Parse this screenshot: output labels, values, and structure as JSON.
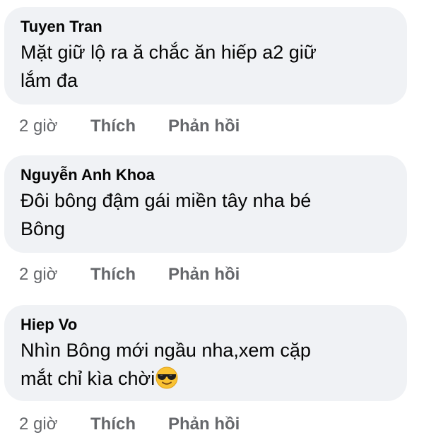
{
  "comments": [
    {
      "author": "Tuyen Tran",
      "text": "Mặt giữ lộ ra ă chắc ăn hiếp a2 giữ\nlắm đa",
      "time": "2 giờ",
      "like": "Thích",
      "reply": "Phản hồi"
    },
    {
      "author": "Nguyễn Anh Khoa",
      "text": "Đôi bông đậm gái miền tây nha bé\nBông",
      "time": "2 giờ",
      "like": "Thích",
      "reply": "Phản hồi"
    },
    {
      "author": "Hiep Vo",
      "text": "Nhìn Bông mới ngầu nha,xem cặp\nmắt chỉ kìa chời",
      "emoji": "smiling-face-with-sunglasses",
      "time": "2 giờ",
      "like": "Thích",
      "reply": "Phản hồi"
    }
  ]
}
